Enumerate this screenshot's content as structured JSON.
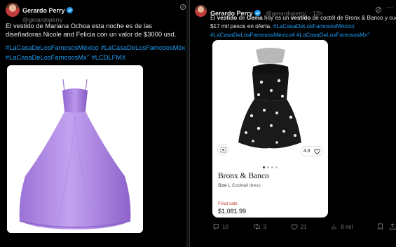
{
  "left_post": {
    "author_name": "Gerardo Perry",
    "handle": "@gerardoperry",
    "body_text": "El vestido de Mariana Ochoa esta noche es de las diseñadoras Nicole and Felicia con un valor de $3000 usd.",
    "hashtags_line1": "#LaCasaDeLosFamososMéxico #LaCasaDeLosFamososMéxico4",
    "hashtags_line2": "#LaCasaDeLosFamososMx",
    "hashtags_line2_tail": " #LCDLFMX",
    "hashtags_line2_sup": "✔",
    "image_alt": "lilac ball gown"
  },
  "right_post": {
    "author_name": "Gerardo Perry",
    "handle": "@gerardoperry",
    "time": "· 12h",
    "body_part1": "El ",
    "body_bold1": "vestido",
    "body_part2": " de ",
    "body_bold2": "Gema",
    "body_part3": " hoy es un ",
    "body_bold3": "vestido",
    "body_part4": " de coctél de Bronx & Banco y cuesta",
    "body_line2": "$17 mil pesos en oferta. ",
    "body_line2_tag": "#LaCasaDeLosFamososMéxico",
    "hashtags_line3": "#LaCasaDeLosFamososMéxico4 #LaCasaDeLosFamososMx",
    "hashtags_line3_sup": "✔",
    "product": {
      "brand": "Bronx & Banco",
      "size_label": "Size L",
      "category": "Cocktail dress",
      "sale_label": "Final sale",
      "price": "$1,081.99",
      "rating": "4.6"
    },
    "actions": {
      "replies": "10",
      "reposts": "3",
      "likes": "21",
      "views": "8 mil"
    }
  },
  "colors": {
    "background": "#000000",
    "text": "#e7e9ea",
    "muted": "#71767b",
    "link": "#1d9bf0",
    "sale_red": "#c0392b",
    "gown": "#b48ee8"
  }
}
